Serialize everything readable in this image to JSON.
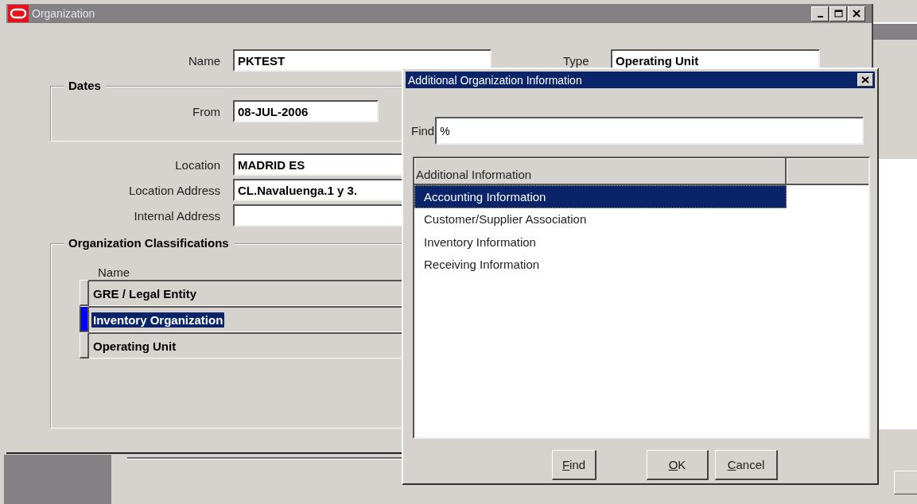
{
  "main_window": {
    "title": "Organization"
  },
  "name": {
    "label": "Name",
    "value": "PKTEST"
  },
  "type": {
    "label": "Type",
    "value": "Operating Unit"
  },
  "dates": {
    "title": "Dates",
    "from": {
      "label": "From",
      "value": "08-JUL-2006"
    }
  },
  "location": {
    "label": "Location",
    "value": "MADRID ES"
  },
  "location_address": {
    "label": "Location Address",
    "value": "CL.Navaluenga.1 y 3."
  },
  "internal_address": {
    "label": "Internal Address"
  },
  "classifications": {
    "title": "Organization Classifications",
    "column": "Name",
    "rows": [
      {
        "value": "GRE / Legal Entity",
        "selected": false
      },
      {
        "value": "Inventory Organization",
        "selected": true
      },
      {
        "value": "Operating Unit",
        "selected": false
      }
    ]
  },
  "dialog": {
    "title": "Additional Organization Information",
    "find": {
      "label": "Find",
      "value": "%"
    },
    "list": {
      "column": "Additional Information",
      "items": [
        {
          "label": "Accounting Information",
          "selected": true
        },
        {
          "label": "Customer/Supplier Association",
          "selected": false
        },
        {
          "label": "Inventory Information",
          "selected": false
        },
        {
          "label": "Receiving Information",
          "selected": false
        }
      ]
    },
    "buttons": [
      "Find",
      "OK",
      "Cancel"
    ]
  }
}
